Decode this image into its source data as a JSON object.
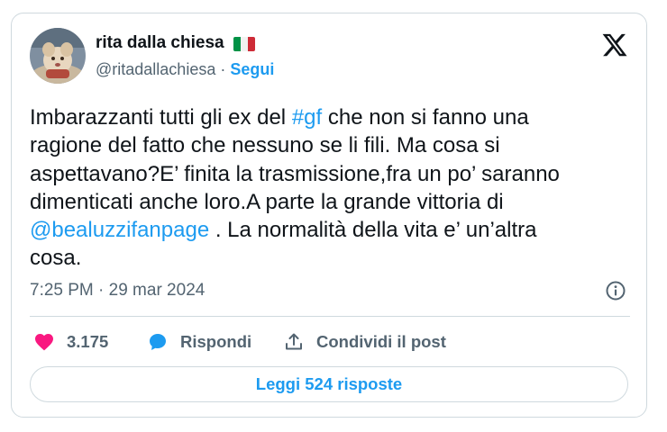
{
  "author": {
    "display_name": "rita dalla chiesa",
    "flag_emoji": "🇮🇹",
    "handle": "@ritadallachiesa",
    "separator": "·",
    "follow_label": "Segui"
  },
  "brand_icon": "x-logo-icon",
  "tweet": {
    "lines": [
      [
        {
          "t": "Imbarazzanti tutti gli ex del "
        },
        {
          "t": "#gf",
          "link": true
        },
        {
          "t": " che non si fanno una"
        }
      ],
      [
        {
          "t": "ragione del fatto che nessuno se li fili. Ma cosa si"
        }
      ],
      [
        {
          "t": "aspettavano?E’ finita la trasmissione,fra un po’ saranno"
        }
      ],
      [
        {
          "t": "dimenticati  anche loro.A parte la grande vittoria di"
        }
      ],
      [
        {
          "t": "@bealuzzifanpage",
          "link": true
        },
        {
          "t": " . La normalità della vita e’ un’altra"
        }
      ],
      [
        {
          "t": "cosa."
        }
      ]
    ]
  },
  "meta": {
    "timestamp": "7:25 PM · 29 mar 2024",
    "info_icon": "info-icon"
  },
  "actions": {
    "like_count": "3.175",
    "reply_label": "Rispondi",
    "share_label": "Condividi il post"
  },
  "read_replies_label": "Leggi 524 risposte",
  "colors": {
    "link": "#1d9bf0",
    "like": "#f91880",
    "muted": "#536471",
    "border": "#cfd9de",
    "text": "#0f1419"
  }
}
